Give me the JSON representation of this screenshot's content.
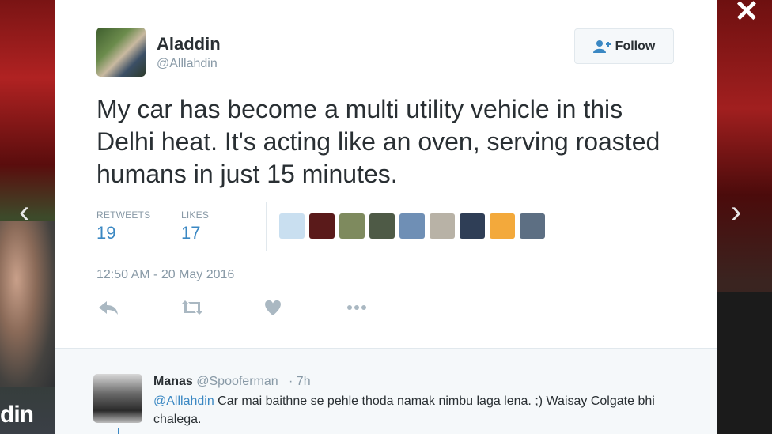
{
  "background": {
    "handle_fragment": "din"
  },
  "overlay": {
    "close_glyph": "✕",
    "prev_glyph": "‹",
    "next_glyph": "›"
  },
  "tweet": {
    "author_name": "Aladdin",
    "author_handle": "@Alllahdin",
    "follow_label": "Follow",
    "text": "My car has become a multi utility vehicle in this Delhi heat. It's acting like an oven, serving roasted humans in just 15 minutes.",
    "stats": {
      "retweets_label": "RETWEETS",
      "retweets_value": "19",
      "likes_label": "LIKES",
      "likes_value": "17"
    },
    "liker_avatars": [
      {
        "color": "#c9dff0"
      },
      {
        "color": "#5a1a1a"
      },
      {
        "color": "#7e8a5e"
      },
      {
        "color": "#4e5a46"
      },
      {
        "color": "#6f8fb5"
      },
      {
        "color": "#b8b2a6"
      },
      {
        "color": "#2f3e56"
      },
      {
        "color": "#f3a93b"
      },
      {
        "color": "#5d6f83"
      }
    ],
    "timestamp": "12:50 AM - 20 May 2016"
  },
  "reply": {
    "name": "Manas",
    "handle": "@Spooferman_",
    "time": "· 7h",
    "mention": "@Alllahdin",
    "text": " Car mai baithne se pehle thoda namak nimbu laga lena. ;) Waisay Colgate bhi chalega."
  },
  "colors": {
    "link_blue": "#3b88c3",
    "text_dark": "#292f33",
    "text_muted": "#8899a6"
  },
  "icons": [
    "reply-icon",
    "retweet-icon",
    "like-heart-icon",
    "more-dots-icon",
    "follow-person-plus-icon",
    "close-icon",
    "chevron-left-icon",
    "chevron-right-icon"
  ]
}
